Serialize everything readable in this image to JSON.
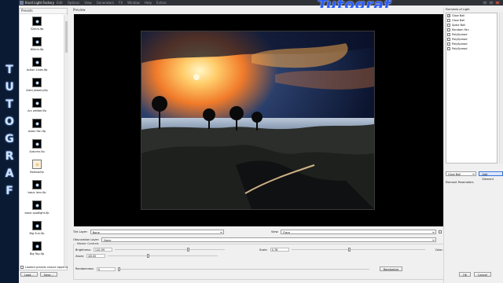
{
  "watermark_text": "Tutograf",
  "brand_vertical_letters": [
    "T",
    "U",
    "T",
    "O",
    "G",
    "R",
    "A",
    "F"
  ],
  "app": {
    "title": "Knoll Light Factory",
    "menus": [
      "Edit",
      "Options",
      "View",
      "Generators",
      "FX",
      "Window",
      "Help",
      "Extras"
    ]
  },
  "presets": {
    "header": "Presets",
    "items": [
      {
        "label": "32mm.lfp"
      },
      {
        "label": "60mm.lfp"
      },
      {
        "label": "Action Lines.lfp"
      },
      {
        "label": "Alien Jewelry.lfp"
      },
      {
        "label": "Arc welder.lfp"
      },
      {
        "label": "Asian Fan.lfp"
      },
      {
        "label": "Autumn.lfp"
      },
      {
        "label": "Bartow.lfp"
      },
      {
        "label": "basic lens.lfp"
      },
      {
        "label": "basic spotlight.lfp"
      },
      {
        "label": "Big Sun.lfp"
      },
      {
        "label": "Big Top.lfp"
      }
    ],
    "footer_checkbox_label": "Loaded presets should append",
    "load_label": "Load...",
    "save_label": "Save..."
  },
  "preview": {
    "header": "Preview"
  },
  "controls": {
    "tint_layer_label": "Tint Layer:",
    "tint_layer_value": "None",
    "view_label": "View:",
    "view_value": "Flare",
    "invert_label": "Invert",
    "obscuration_label": "Obscuration Layer:",
    "obscuration_value": "None",
    "master_title": "Master Controls",
    "brightness_label": "Brightness:",
    "brightness_value": "110.99",
    "scale_label": "Scale:",
    "scale_value": "0.76",
    "color_label": "Color:",
    "color_hex": "#f1b900",
    "zoom_label": "Zoom:",
    "zoom_value": "48.00",
    "randomness_label": "Randomness:",
    "randomness_value": "0",
    "randomize_label": "Randomize"
  },
  "elements": {
    "header": "Elements of Light",
    "items": [
      {
        "label": "Glow Ball",
        "checked": true
      },
      {
        "label": "Glow Ball",
        "checked": false
      },
      {
        "label": "Spike Ball",
        "checked": false
      },
      {
        "label": "Random Fan",
        "checked": false
      },
      {
        "label": "PolySpread",
        "checked": false
      },
      {
        "label": "PolySpread",
        "checked": false
      },
      {
        "label": "PolySpread",
        "checked": false
      },
      {
        "label": "PolySpread",
        "checked": false
      }
    ],
    "selected_element": "Glow Ball",
    "add_label": "Add Element",
    "parameters_label": "Element Parameters"
  },
  "footer": {
    "ok_label": "OK",
    "cancel_label": "Cancel"
  }
}
